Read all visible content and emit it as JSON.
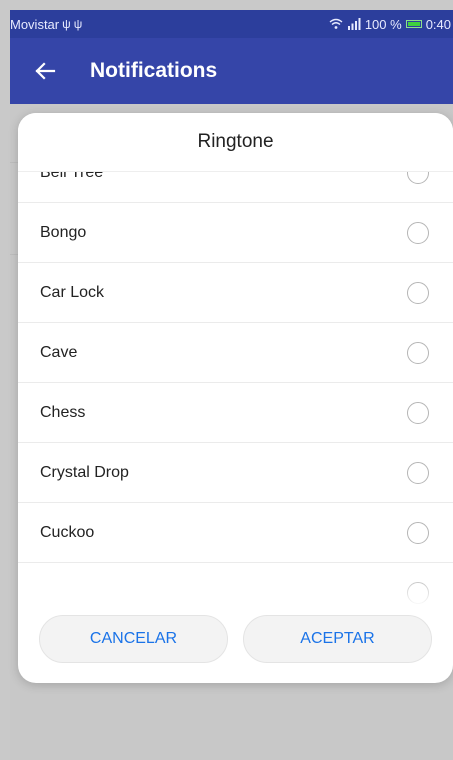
{
  "status_bar": {
    "carrier": "Movistar",
    "usb_icons": [
      "usb-icon",
      "usb-icon"
    ],
    "battery_percent": "100 %",
    "time": "0:40"
  },
  "app_bar": {
    "title": "Notifications",
    "back_icon": "arrow-left-icon"
  },
  "dialog": {
    "title": "Ringtone",
    "items": [
      {
        "label": "Bell Tree"
      },
      {
        "label": "Bongo"
      },
      {
        "label": "Car Lock"
      },
      {
        "label": "Cave"
      },
      {
        "label": "Chess"
      },
      {
        "label": "Crystal Drop"
      },
      {
        "label": "Cuckoo"
      }
    ],
    "cancel_label": "CANCELAR",
    "accept_label": "ACEPTAR"
  },
  "colors": {
    "app_bar": "#3545a8",
    "status_bar": "#2c3e9c",
    "accent": "#1a73e8"
  }
}
